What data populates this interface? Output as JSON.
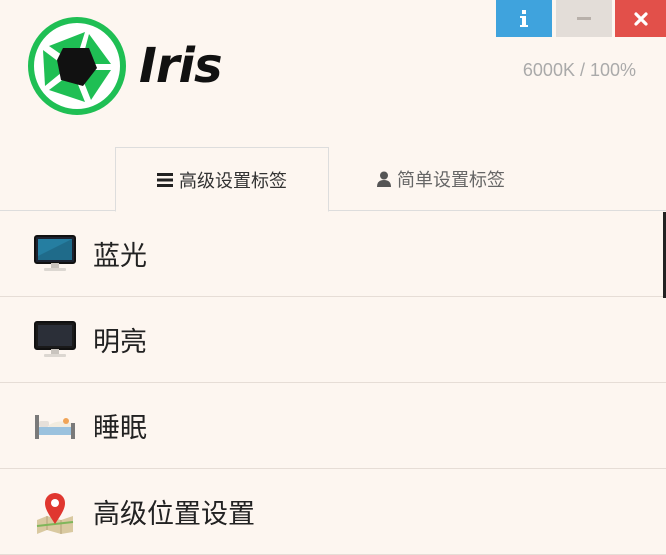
{
  "window": {
    "buttons": {
      "info": "i",
      "minimize": "—",
      "close": "✕"
    }
  },
  "app": {
    "name": "Iris",
    "color_temp": "6000K / 100%"
  },
  "tabs": [
    {
      "label": "高级设置标签",
      "icon": "bars-icon",
      "active": true
    },
    {
      "label": "简单设置标签",
      "icon": "user-icon",
      "active": false
    }
  ],
  "menu": [
    {
      "label": "蓝光",
      "icon": "monitor-blue-icon"
    },
    {
      "label": "明亮",
      "icon": "monitor-dark-icon"
    },
    {
      "label": "睡眠",
      "icon": "bed-icon"
    },
    {
      "label": "高级位置设置",
      "icon": "map-pin-icon"
    }
  ],
  "colors": {
    "info": "#3fa3dd",
    "close": "#e2504a",
    "logo_green": "#1fbf54"
  }
}
